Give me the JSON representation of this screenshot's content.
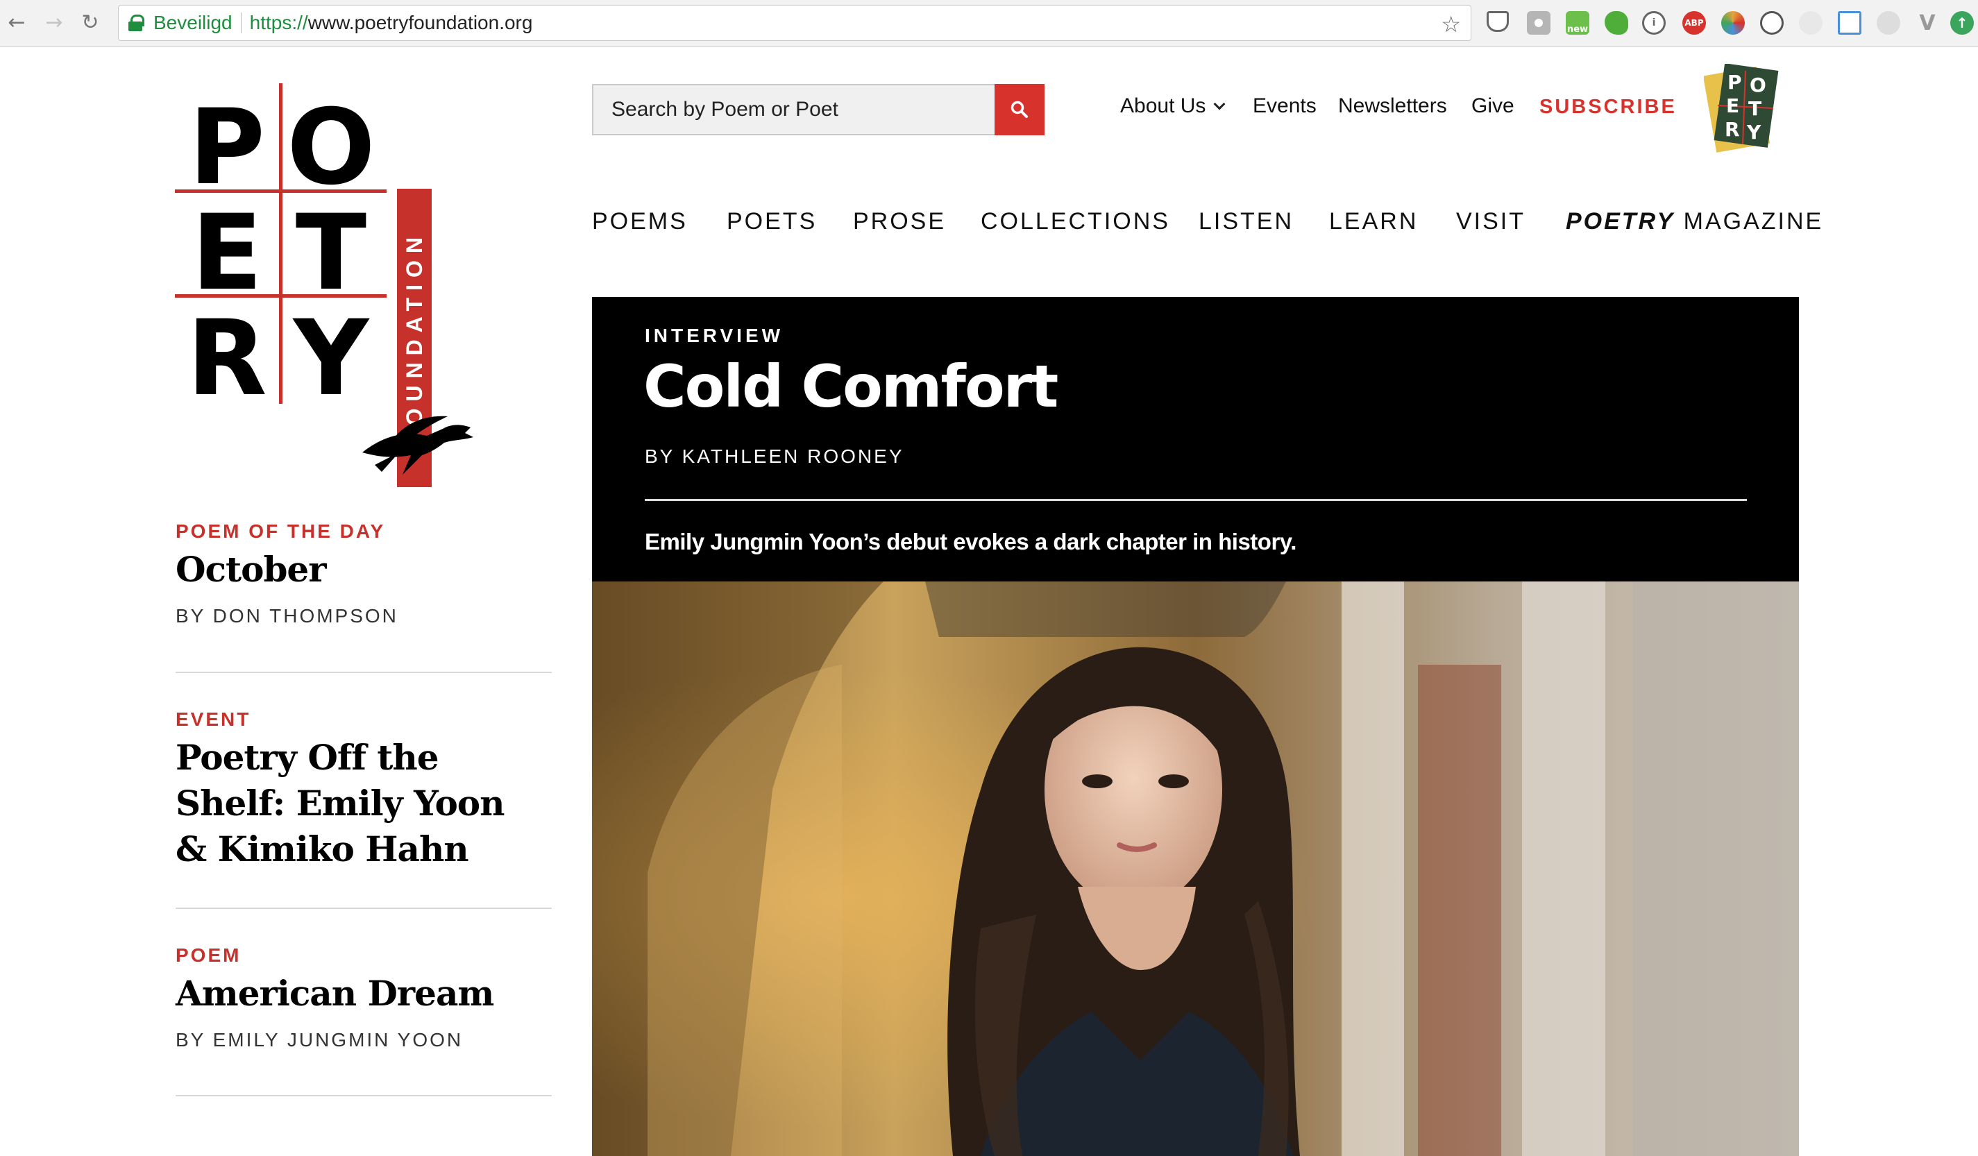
{
  "browser": {
    "secure_label": "Beveiligd",
    "url_protocol": "https://",
    "url_host": "www.poetryfoundation.org",
    "back_icon": "arrow-left-icon",
    "forward_icon": "arrow-right-icon",
    "reload_icon": "reload-icon",
    "star_icon": "star-icon",
    "extensions": [
      {
        "name": "pocket-icon",
        "color": "#666"
      },
      {
        "name": "camera-icon",
        "color": "#aaa"
      },
      {
        "name": "new-badge-icon",
        "color": "#6cbf4a",
        "label": "new"
      },
      {
        "name": "evernote-icon",
        "color": "#4fae3a"
      },
      {
        "name": "onepassword-icon",
        "color": "#666"
      },
      {
        "name": "adblock-icon",
        "color": "#d7322c",
        "label": "ABP"
      },
      {
        "name": "color-picker-icon",
        "color": "#e6a23c"
      },
      {
        "name": "react-icon",
        "color": "#555"
      },
      {
        "name": "settings-icon",
        "color": "#ccc"
      },
      {
        "name": "grid-icon",
        "color": "#4a90d9"
      },
      {
        "name": "circle-icon",
        "color": "#bbb"
      },
      {
        "name": "vue-icon",
        "color": "#999"
      },
      {
        "name": "update-icon",
        "color": "#3ba55d"
      }
    ]
  },
  "logo": {
    "letters": [
      "P",
      "O",
      "E",
      "T",
      "R",
      "Y"
    ],
    "side_text": "FOUNDATION",
    "brand_red": "#c7312c"
  },
  "header": {
    "search_placeholder": "Search by Poem or Poet",
    "search_icon": "search-icon",
    "utility_nav": {
      "about": "About Us",
      "events": "Events",
      "newsletters": "Newsletters",
      "give": "Give",
      "subscribe": "SUBSCRIBE"
    },
    "magazine_badge": {
      "letters": [
        "P",
        "O",
        "E",
        "T",
        "R",
        "Y"
      ]
    }
  },
  "main_nav": {
    "poems": "POEMS",
    "poets": "POETS",
    "prose": "PROSE",
    "collections": "COLLECTIONS",
    "listen": "LISTEN",
    "learn": "LEARN",
    "visit": "VISIT",
    "magazine_italic": "POETRY",
    "magazine_rest": " MAGAZINE"
  },
  "sidebar": {
    "items": [
      {
        "kicker": "POEM OF THE DAY",
        "title": "October",
        "byline": "BY DON THOMPSON"
      },
      {
        "kicker": "EVENT",
        "title": "Poetry Off the Shelf: Emily Yoon & Kimiko Hahn",
        "byline": ""
      },
      {
        "kicker": "POEM",
        "title": "American Dream",
        "byline": "BY EMILY JUNGMIN YOON"
      }
    ]
  },
  "feature": {
    "kicker": "INTERVIEW",
    "title": "Cold Comfort",
    "byline": "BY KATHLEEN ROONEY",
    "dek": "Emily Jungmin Yoon’s debut evokes a dark chapter in history."
  }
}
